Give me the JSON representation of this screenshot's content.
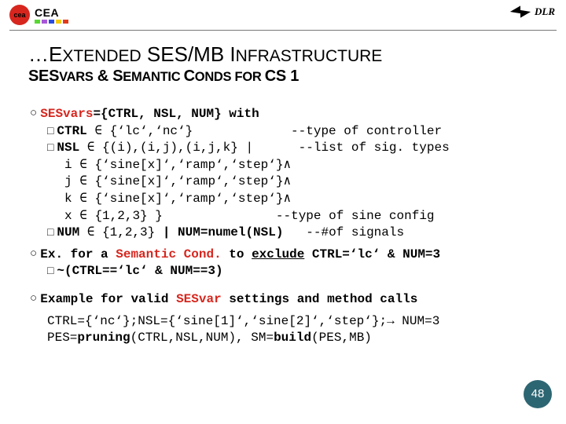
{
  "header": {
    "left_logo_label": "cea",
    "left_logo_text": "CEA",
    "right_logo_label": "DLR"
  },
  "title": {
    "prefix": "…E",
    "prefix_sc": "XTENDED",
    "mid": " SES/MB I",
    "tail_sc": "NFRASTRUCTURE",
    "sub_a": "SES",
    "sub_a_sc": "VARS",
    "amp": " & ",
    "sub_b": "S",
    "sub_b_sc": "EMANTIC ",
    "sub_c": "C",
    "sub_c_sc": "ONDS FOR ",
    "tail": "CS 1"
  },
  "lines": {
    "l0a": "SESvars",
    "l0b": "={CTRL, NSL, NUM} with",
    "l1a": "CTRL",
    "l1b": " ∈ {‘lc‘,‘nc‘}",
    "l1c": "             --type of controller",
    "l2a": "NSL",
    "l2b": " ∈ {(i),(i,j),(i,j,k} |",
    "l2c": "      --list of sig. types",
    "l3": "i ∈ {‘sine[x]‘,‘ramp‘,‘step‘}∧",
    "l4": "j ∈ {‘sine[x]‘,‘ramp‘,‘step‘}∧",
    "l5": "k ∈ {‘sine[x]‘,‘ramp‘,‘step‘}∧",
    "l6a": "x ∈ {1,2,3} }",
    "l6b": "               --type of sine config",
    "l7a": "NUM",
    "l7b": " ∈ {1,2,3} ",
    "l7c": "| NUM=numel(NSL)",
    "l7d": "   --#of signals",
    "l8a": "Ex. for a ",
    "l8b": "Semantic Cond.",
    "l8c": " to ",
    "l8d": "exclude",
    "l8e": " CTRL=‘lc‘ & NUM=3",
    "l9a": "~(CTRL==‘lc‘ & NUM==3)",
    "l10a": "Example for valid ",
    "l10b": "SESvar",
    "l10c": " settings and method calls",
    "l11a": "CTRL={‘nc‘};NSL={‘sine[1]‘,‘sine[2]‘,‘step‘};",
    "l11b": "→ NUM=3",
    "l12a": "PES=",
    "l12b": "pruning",
    "l12c": "(CTRL,NSL,NUM), SM=",
    "l12d": "build",
    "l12e": "(PES,MB)"
  },
  "page_number": "48"
}
